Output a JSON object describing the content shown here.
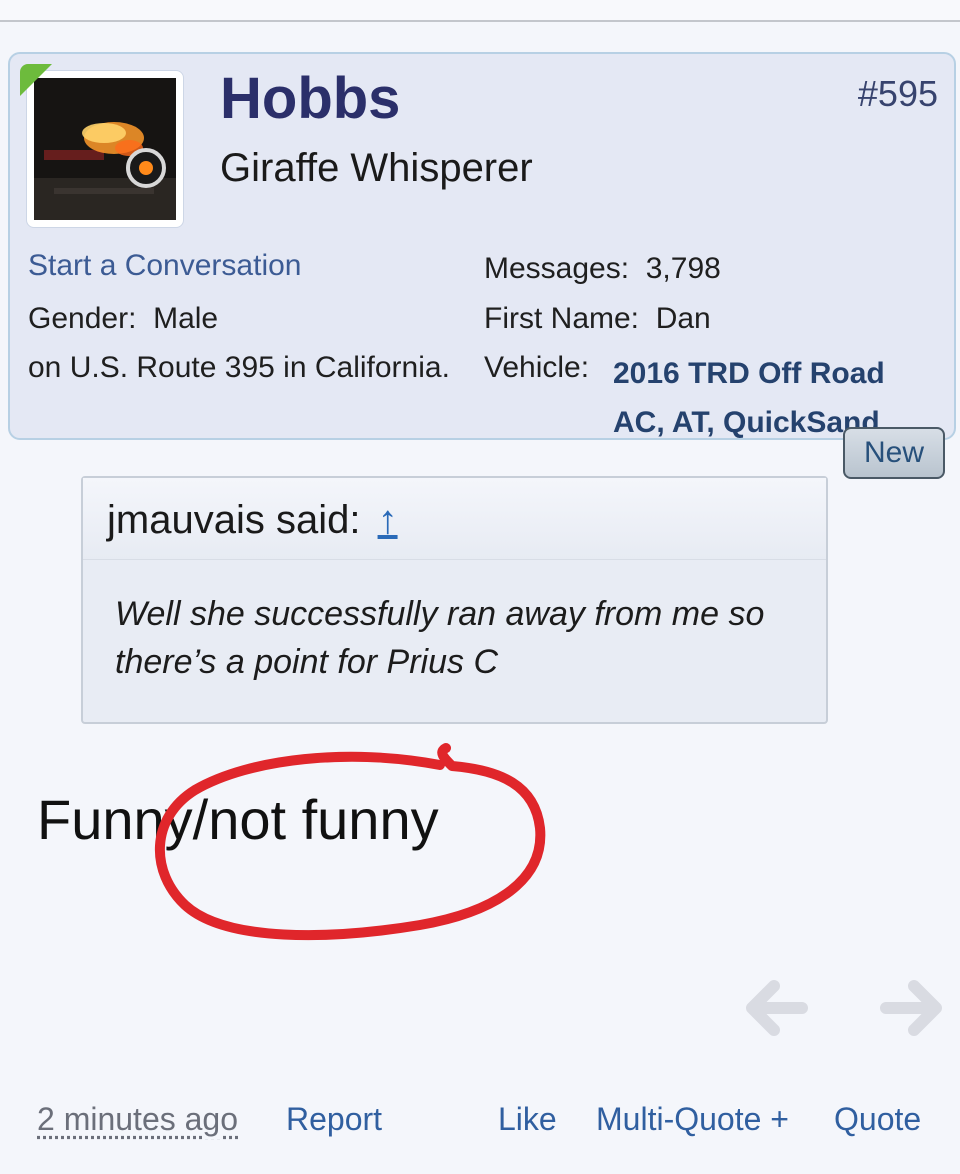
{
  "post": {
    "number": "#595",
    "author": {
      "username": "Hobbs",
      "title": "Giraffe Whisperer",
      "start_conversation": "Start a Conversation",
      "fields": {
        "gender_label": "Gender:",
        "gender_value": "Male",
        "location": "on U.S. Route 395 in California.",
        "messages_label": "Messages:",
        "messages_value": "3,798",
        "first_name_label": "First Name:",
        "first_name_value": "Dan",
        "vehicle_label": "Vehicle:",
        "vehicle_line1": "2016 TRD Off Road",
        "vehicle_line2": "AC, AT, QuickSand"
      }
    },
    "badge": "New",
    "quote": {
      "author": "jmauvais said:",
      "jump": "↑",
      "line1": "Well she successfully ran away from me so",
      "line2": "there’s a point for Prius C"
    },
    "message": "Funny/not funny",
    "footer": {
      "time": "2 minutes ago",
      "report": "Report",
      "like": "Like",
      "multi_quote": "Multi-Quote +",
      "quote": "Quote"
    }
  },
  "icons": {
    "prev": "arrow-left-icon",
    "next": "arrow-right-icon"
  },
  "colors": {
    "card_bg": "#e4e8f4",
    "username": "#2b2f6a",
    "link": "#305fa0",
    "annotation_red": "#e0262b",
    "online": "#6dbb3c"
  }
}
